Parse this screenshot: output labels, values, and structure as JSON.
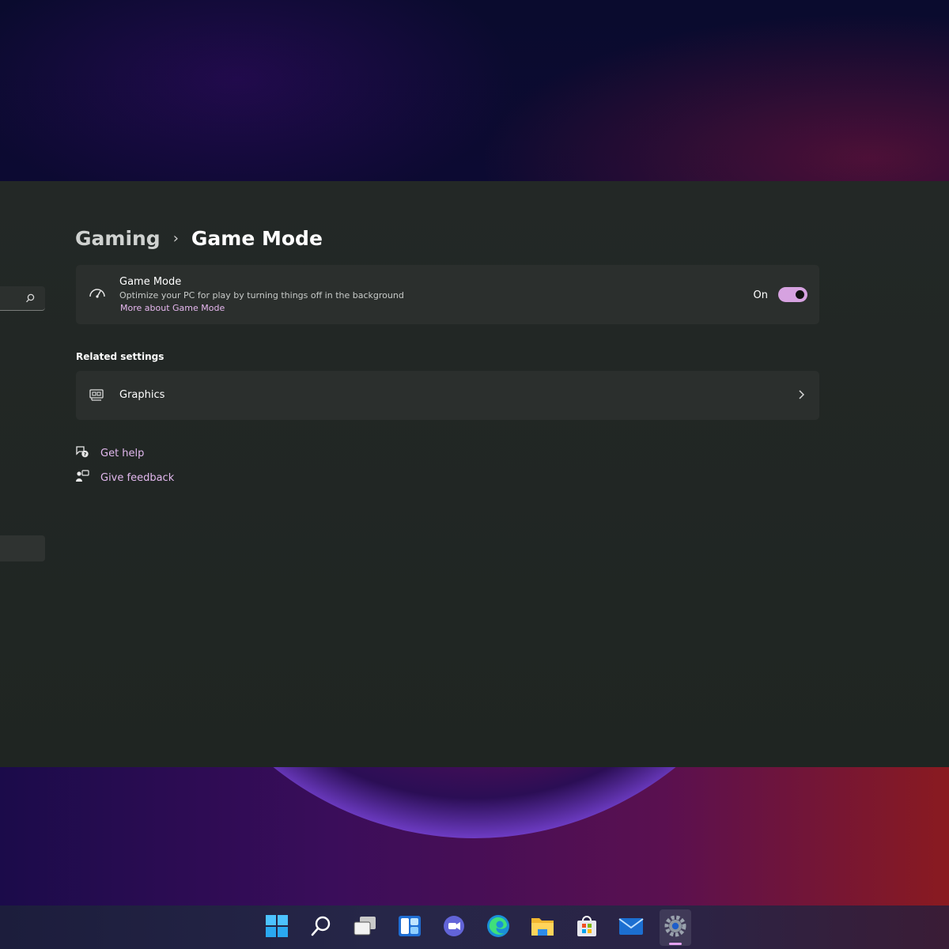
{
  "breadcrumb": {
    "parent": "Gaming",
    "separator": "›",
    "current": "Game Mode"
  },
  "game_mode_card": {
    "title": "Game Mode",
    "description": "Optimize your PC for play by turning things off in the background",
    "link": "More about Game Mode",
    "toggle_label": "On",
    "toggle_on": true,
    "icon": "game-mode-gauge-icon"
  },
  "related_settings": {
    "heading": "Related settings",
    "items": [
      {
        "label": "Graphics",
        "icon": "graphics-card-icon"
      }
    ]
  },
  "help": {
    "get_help": "Get help",
    "give_feedback": "Give feedback"
  },
  "taskbar": {
    "items": [
      {
        "name": "start-icon"
      },
      {
        "name": "search-icon"
      },
      {
        "name": "task-view-icon"
      },
      {
        "name": "widgets-icon"
      },
      {
        "name": "chat-icon"
      },
      {
        "name": "edge-icon"
      },
      {
        "name": "file-explorer-icon"
      },
      {
        "name": "store-icon"
      },
      {
        "name": "mail-icon"
      },
      {
        "name": "settings-icon",
        "active": true
      }
    ]
  },
  "colors": {
    "accent": "#d6a2e0",
    "link": "#e2b8ee",
    "window_bg": "#202523",
    "card_bg": "#2b2f2d"
  }
}
